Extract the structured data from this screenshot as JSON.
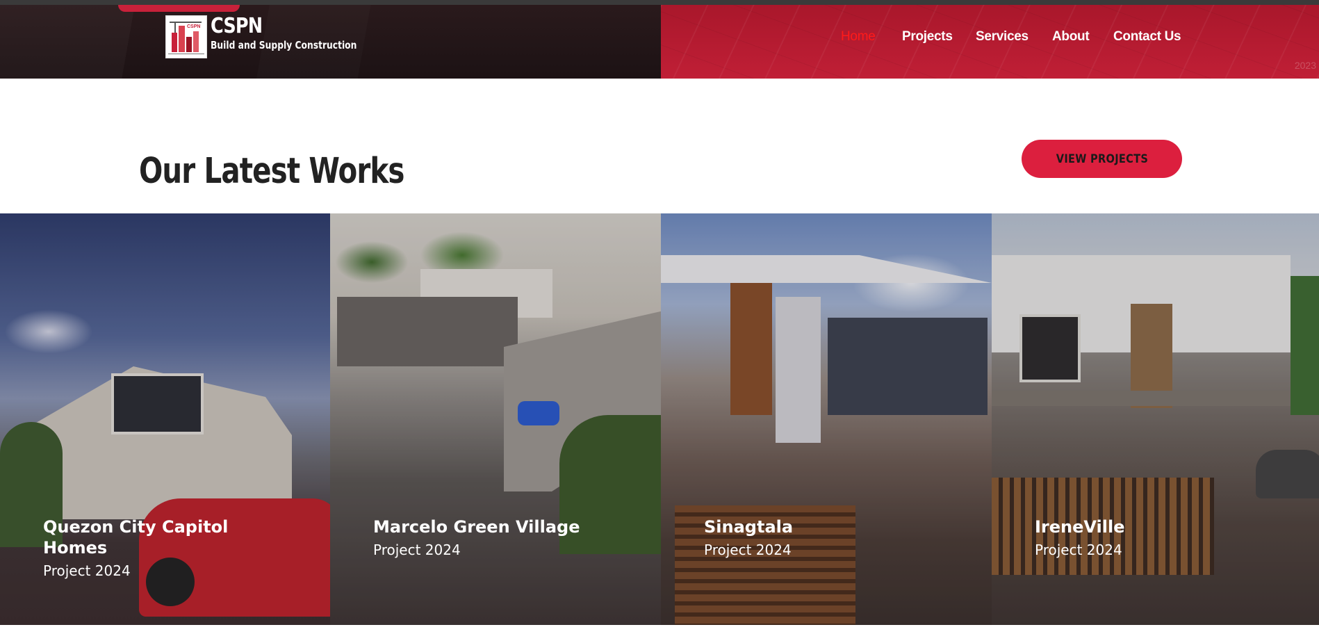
{
  "brand": {
    "name": "CSPN",
    "tagline": "Build and Supply Construction",
    "logo_text": "CSPN"
  },
  "nav": [
    {
      "label": "Home",
      "active": true
    },
    {
      "label": "Projects",
      "active": false
    },
    {
      "label": "Services",
      "active": false
    },
    {
      "label": "About",
      "active": false
    },
    {
      "label": "Contact Us",
      "active": false
    }
  ],
  "header_year_tag": "2023",
  "section": {
    "title": "Our Latest Works",
    "button_label": "VIEW PROJECTS"
  },
  "projects": [
    {
      "title": "Quezon City Capitol Homes",
      "subtitle": "Project 2024"
    },
    {
      "title": "Marcelo Green Village",
      "subtitle": "Project 2024"
    },
    {
      "title": "Sinagtala",
      "subtitle": "Project 2024"
    },
    {
      "title": "IreneVille",
      "subtitle": "Project 2024"
    }
  ],
  "colors": {
    "accent": "#dc1f3e",
    "header_dark": "#1c1214",
    "header_red": "#b81b31",
    "nav_active": "#ff1a1a"
  }
}
